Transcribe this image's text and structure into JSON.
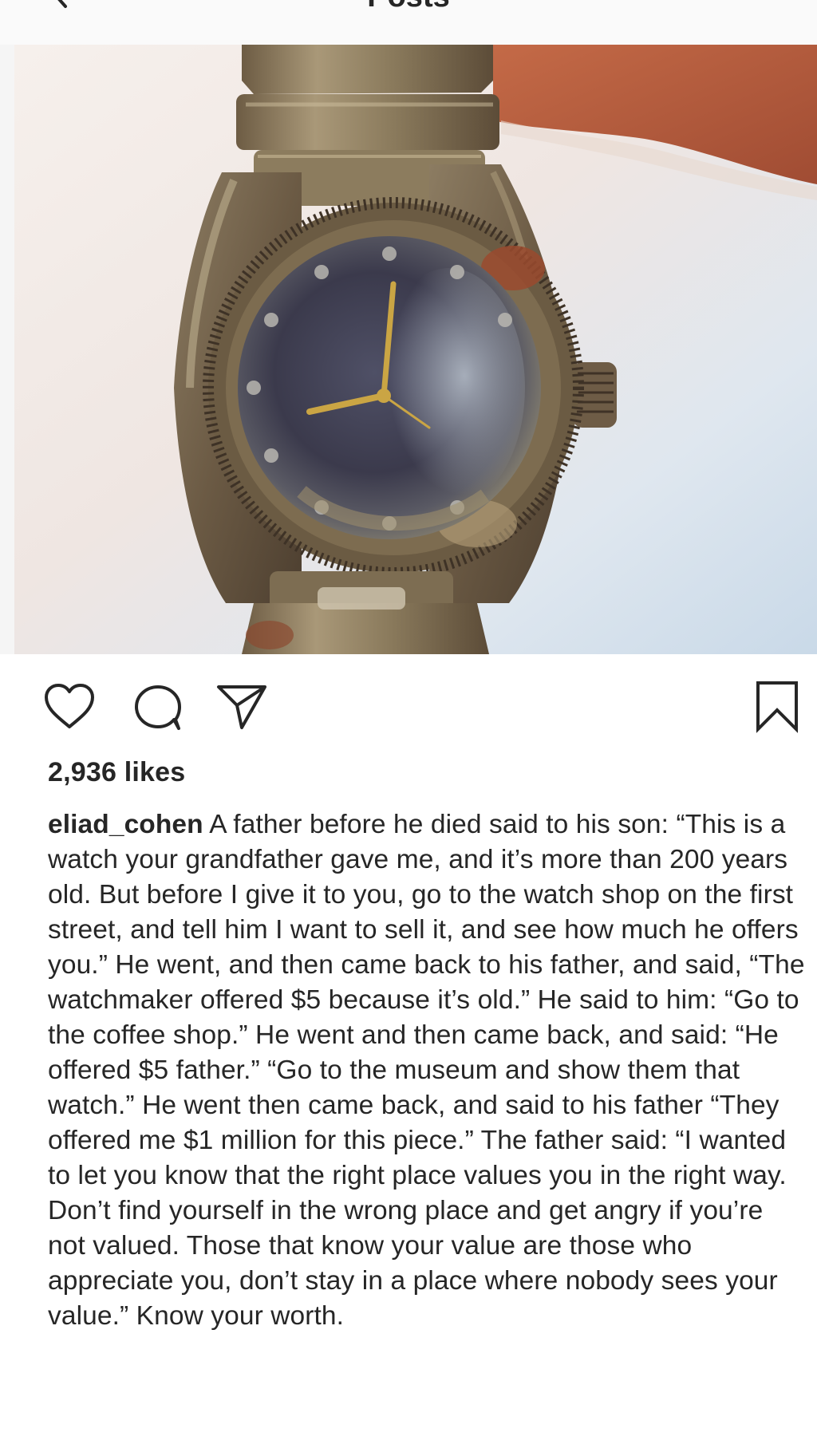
{
  "header": {
    "title": "Posts",
    "back_icon": "chevron-left-icon"
  },
  "post": {
    "image_alt": "Old corroded wristwatch held up against a pale sky",
    "actions": {
      "like_icon": "heart-icon",
      "comment_icon": "comment-bubble-icon",
      "share_icon": "paper-plane-icon",
      "save_icon": "bookmark-icon"
    },
    "likes": "2,936 likes",
    "caption": {
      "username": "eliad_cohen",
      "text": "A father before he died said to his son: “This is a watch your grandfather gave me, and it’s more than 200 years old. But before I give it to you, go to the watch shop on the first street, and tell him I want to sell it, and see how much he offers you.” He went, and then came back to his father, and said, “The watchmaker offered $5 because it’s old.” He said to him: “Go to the coffee shop.” He went and then came back, and said: “He offered $5 father.” “Go to the museum and show them that watch.” He went then came back, and said to his father “They offered me $1 million for this piece.” The father said: “I wanted to let you know that the right place values you in the right way. Don’t find yourself in the wrong place and get angry if you’re not valued. Those that know your value are those who appreciate you, don’t stay in a place where nobody sees your value.” Know your worth."
    }
  },
  "colors": {
    "text": "#262626",
    "header_bg": "#fafafa",
    "divider": "#dbdbdb"
  }
}
